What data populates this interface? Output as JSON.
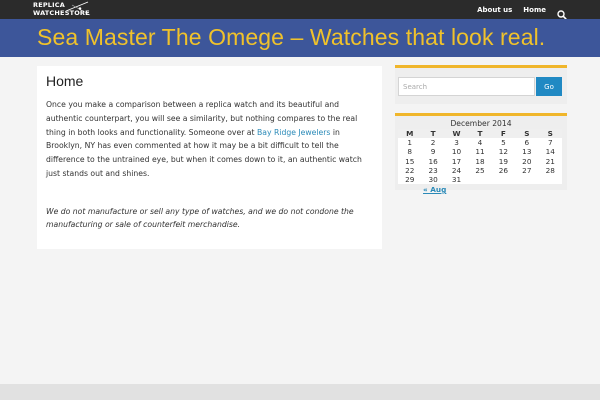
{
  "site": {
    "logo_line1": "REPLICA",
    "logo_line2": "WATCHESTORE",
    "title": "Sea Master The Omege – Watches that look real."
  },
  "nav": {
    "items": [
      {
        "label": "About us"
      },
      {
        "label": "Home"
      }
    ],
    "search_icon": "search-icon"
  },
  "page": {
    "heading": "Home",
    "paragraph1_before_link": "Once you make a comparison between a replica watch and its beautiful and authentic counterpart, you will see a similarity, but nothing compares to the real thing in both looks and functionality. Someone over at ",
    "paragraph1_link": "Bay Ridge Jewelers",
    "paragraph1_after_link": " in Brooklyn, NY has even commented at how it may be a bit difficult to tell the difference to the untrained eye, but when it comes down to it, an authentic watch just stands out and shines.",
    "disclaimer": "We do not manufacture or sell any type of watches, and we do not condone the manufacturing or sale of counterfeit merchandise."
  },
  "sidebar": {
    "search": {
      "placeholder": "Search",
      "button_label": "Go"
    },
    "calendar": {
      "caption": "December 2014",
      "weekdays": [
        "M",
        "T",
        "W",
        "T",
        "F",
        "S",
        "S"
      ],
      "weeks": [
        [
          "1",
          "2",
          "3",
          "4",
          "5",
          "6",
          "7"
        ],
        [
          "8",
          "9",
          "10",
          "11",
          "12",
          "13",
          "14"
        ],
        [
          "15",
          "16",
          "17",
          "18",
          "19",
          "20",
          "21"
        ],
        [
          "22",
          "23",
          "24",
          "25",
          "26",
          "27",
          "28"
        ],
        [
          "29",
          "30",
          "31",
          "",
          "",
          "",
          ""
        ]
      ],
      "prev_link": "« Aug"
    }
  },
  "colors": {
    "topbar": "#2b2b2b",
    "banner": "#3d569a",
    "title": "#f0c22b",
    "accent": "#f0b62b",
    "link": "#2a8ab8",
    "button": "#2089c3"
  }
}
